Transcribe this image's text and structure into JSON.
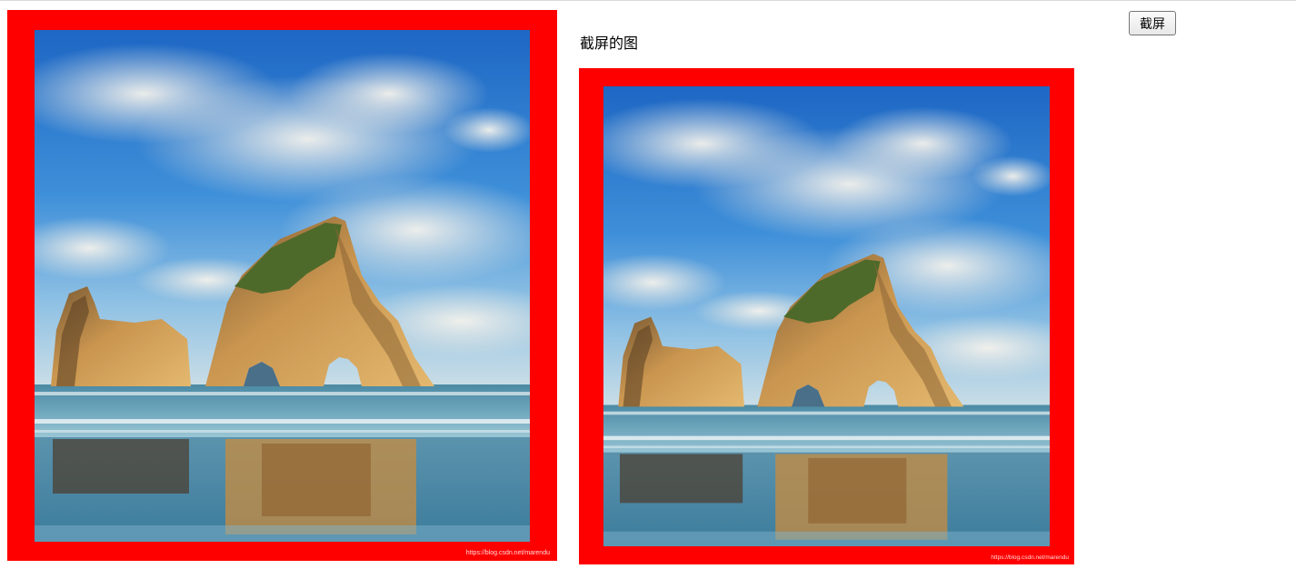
{
  "caption": "截屏的图",
  "screenshot_button": {
    "label": "截屏"
  },
  "image": {
    "watermark": "https://blog.csdn.net/marendu",
    "scene": "sea-arch-rocks-beach",
    "border_color": "#ff0000"
  }
}
